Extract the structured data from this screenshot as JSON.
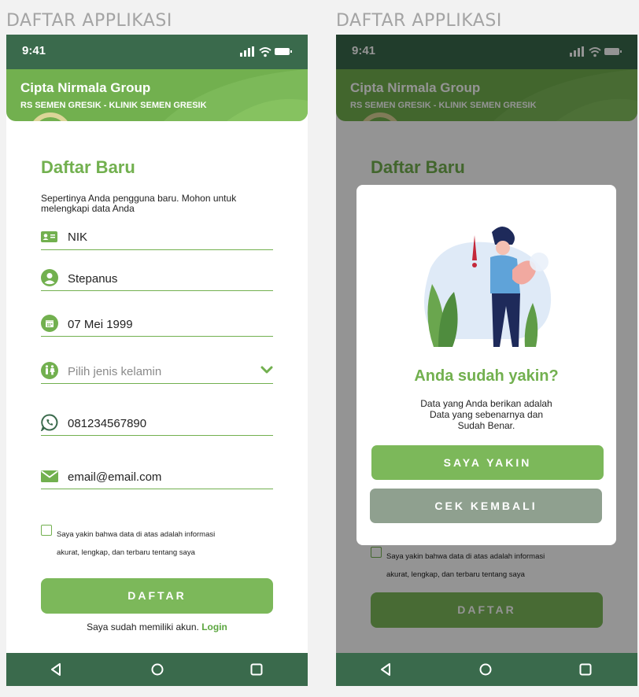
{
  "frames": [
    {
      "title": "DAFTAR APPLIKASI"
    },
    {
      "title": "DAFTAR APPLIKASI"
    }
  ],
  "status": {
    "time": "9:41",
    "icons": [
      "signal-icon",
      "wifi-icon",
      "battery-icon"
    ]
  },
  "header": {
    "company": "Cipta Nirmala Group",
    "subtitle": "RS SEMEN GRESIK - KLINIK SEMEN GRESIK"
  },
  "form": {
    "title": "Daftar Baru",
    "description": "Sepertinya Anda pengguna baru. Mohon untuk melengkapi data Anda",
    "fields": [
      {
        "icon": "id-card-icon",
        "value": "NIK",
        "placeholder": false
      },
      {
        "icon": "user-icon",
        "value": "Stepanus",
        "placeholder": false
      },
      {
        "icon": "calendar-icon",
        "value": "07 Mei 1999",
        "placeholder": false
      },
      {
        "icon": "gender-icon",
        "value": "Pilih jenis kelamin",
        "placeholder": true
      },
      {
        "icon": "whatsapp-icon",
        "value": "081234567890",
        "placeholder": false
      },
      {
        "icon": "mail-icon",
        "value": "email@email.com",
        "placeholder": false
      }
    ],
    "consent_line1": "Saya yakin bahwa data di atas adalah informasi",
    "consent_line2": "akurat, lengkap, dan terbaru tentang saya",
    "submit_label": "DAFTAR",
    "login_prompt": "Saya sudah memiliki akun.",
    "login_link": "Login"
  },
  "dialog": {
    "title": "Anda sudah yakin?",
    "message_line1": "Data yang Anda berikan adalah",
    "message_line2": "Data yang sebenarnya dan",
    "message_line3": "Sudah Benar.",
    "confirm_label": "SAYA YAKIN",
    "back_label": "CEK  KEMBALI"
  },
  "navbar": {
    "items": [
      "back-icon",
      "home-icon",
      "recents-icon"
    ]
  },
  "colors": {
    "primary": "#72b04f",
    "dark": "#3a6a4c",
    "muted": "#8fa08f"
  }
}
